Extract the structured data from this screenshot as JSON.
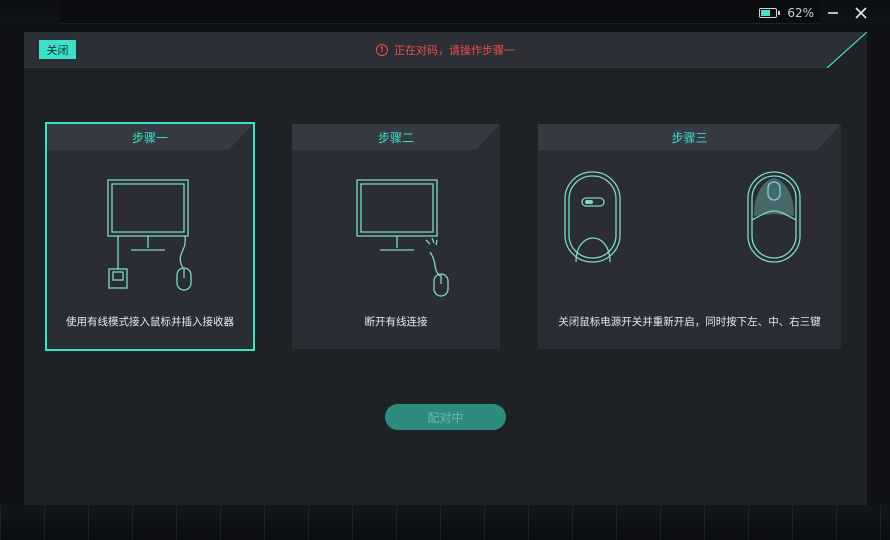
{
  "window": {
    "battery_percent": "62%",
    "battery_level": 0.62,
    "minimize_icon": "minimize-icon",
    "close_icon": "close-icon"
  },
  "dialog": {
    "close_label": "关闭",
    "status_text": "正在对码，请操作步骤一",
    "status_icon": "warning-icon",
    "colors": {
      "accent": "#3ee0c8",
      "warning": "#f04b4b",
      "panel": "#1e2126",
      "card": "#2a2d33"
    }
  },
  "steps": [
    {
      "title": "步骤一",
      "description": "使用有线模式接入鼠标并插入接收器",
      "active": true
    },
    {
      "title": "步骤二",
      "description": "断开有线连接",
      "active": false
    },
    {
      "title": "步骤三",
      "description": "关闭鼠标电源开关并重新开启，同时按下左、中、右三键",
      "active": false
    }
  ],
  "pair_button_label": "配对中"
}
